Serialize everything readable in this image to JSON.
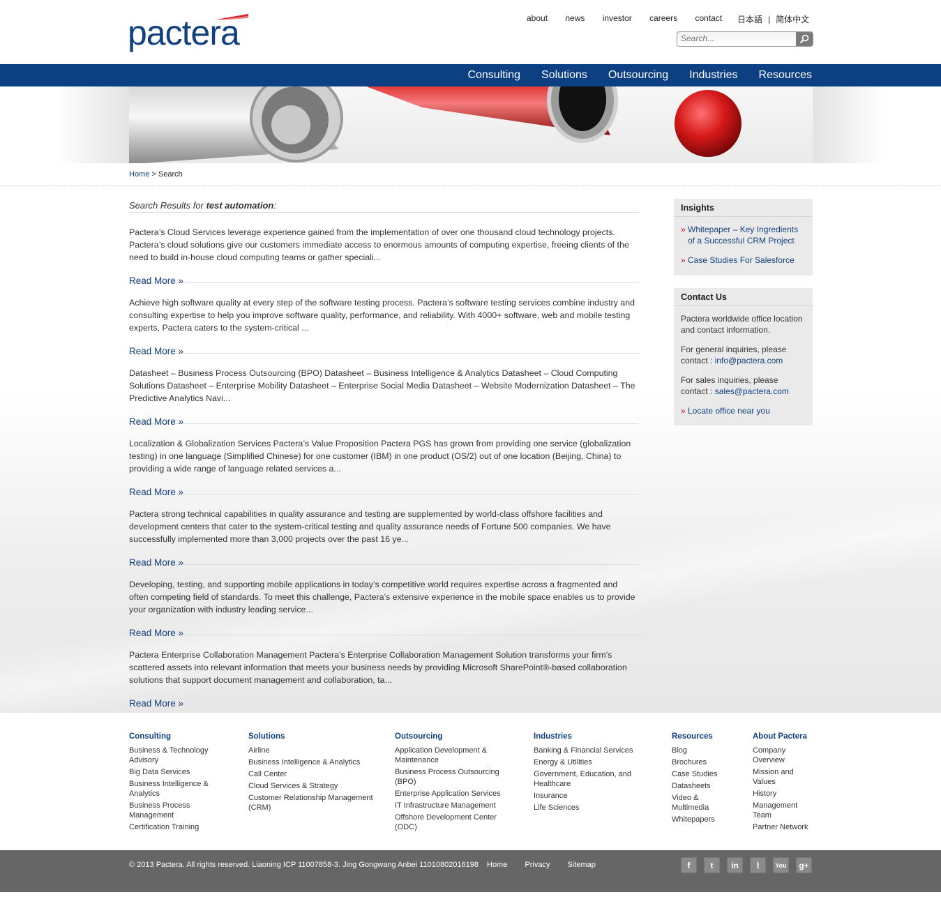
{
  "brand": {
    "logo": "pactera",
    "accent": "#0d3f83",
    "link": "#11407e",
    "bullet": "#c21a1a"
  },
  "top_links": [
    "about",
    "news",
    "investor",
    "careers",
    "contact"
  ],
  "lang": {
    "ja": "日本語",
    "sep": "|",
    "zh": "简体中文"
  },
  "search": {
    "placeholder": "Search..."
  },
  "nav": [
    "Consulting",
    "Solutions",
    "Outsourcing",
    "Industries",
    "Resources"
  ],
  "breadcrumb": {
    "home": "Home",
    "sep": ">",
    "current": "Search"
  },
  "results": {
    "prefix": "Search Results for",
    "query": "test automation",
    "suffix": ":",
    "more": "Read More »",
    "items": [
      "Pactera’s Cloud Services leverage experience gained from the implementation of over one thousand cloud technology projects. Pactera’s cloud solutions give our customers immediate access to enormous amounts of computing expertise, freeing clients of the need to build in-house cloud computing teams or gather speciali...",
      "Achieve high software quality at every step of the software testing process. Pactera’s software testing services combine industry and consulting expertise to help you improve software quality, performance, and reliability. With 4000+ software, web and mobile testing experts, Pactera caters to the system-critical ...",
      "Datasheet – Business Process Outsourcing (BPO) Datasheet – Business Intelligence & Analytics Datasheet – Cloud Computing Solutions Datasheet – Enterprise Mobility Datasheet – Enterprise Social Media Datasheet – Website Modernization Datasheet – The Predictive Analytics Navi...",
      "Localization & Globalization Services Pactera’s Value Proposition Pactera PGS has grown from providing one service (globalization testing) in one language (Simplified Chinese) for one customer (IBM) in one product (OS/2) out of one location (Beijing, China) to providing a wide range of language related services a...",
      "Pactera strong technical capabilities in quality assurance and testing are supplemented by world-class offshore facilities and development centers that cater to the system-critical testing and quality assurance needs of Fortune 500 companies. We have successfully implemented more than 3,000 projects over the past 16 ye...",
      "Developing, testing, and supporting mobile applications in today’s competitive world requires expertise across a fragmented and often competing field of standards. To meet this challenge, Pactera’s extensive experience in the mobile space enables us to provide your organization with industry leading service...",
      "Pactera Enterprise Collaboration Management Pactera’s Enterprise Collaboration Management Solution transforms your firm’s scattered assets into relevant information that meets your business needs by providing Microsoft SharePoint®-based collaboration solutions that support document management and collaboration, ta..."
    ]
  },
  "insights": {
    "title": "Insights",
    "links": [
      "Whitepaper – Key Ingredients of a Successful CRM Project",
      "Case Studies For Salesforce"
    ]
  },
  "contact": {
    "title": "Contact Us",
    "intro": "Pactera worldwide office location and contact information.",
    "general": "For general inquiries, please contact :",
    "general_email": "info@pactera.com",
    "sales": "For sales inquiries, please contact :",
    "sales_email": "sales@pactera.com",
    "locate": "Locate office near you"
  },
  "footer": {
    "columns": [
      {
        "title": "Consulting",
        "items": [
          "Business & Technology Advisory",
          "Big Data Services",
          "Business Intelligence & Analytics",
          "Business Process Management",
          "Certification Training"
        ]
      },
      {
        "title": "Solutions",
        "items": [
          "Airline",
          "Business Intelligence & Analytics",
          "Call Center",
          "Cloud Services & Strategy",
          "Customer Relationship Management (CRM)"
        ]
      },
      {
        "title": "Outsourcing",
        "items": [
          "Application Development & Maintenance",
          "Business Process Outsourcing (BPO)",
          "Enterprise Application Services",
          "IT Infrastructure Management",
          "Offshore Development Center (ODC)"
        ]
      },
      {
        "title": "Industries",
        "items": [
          "Banking & Financial Services",
          "Energy & Utilities",
          "Government, Education, and Healthcare",
          "Insurance",
          "Life Sciences"
        ]
      },
      {
        "title": "Resources",
        "items": [
          "Blog",
          "Brochures",
          "Case Studies",
          "Datasheets",
          "Video & Multimedia",
          "Whitepapers"
        ]
      },
      {
        "title": "About Pactera",
        "items": [
          "Company Overview",
          "Mission and Values",
          "History",
          "Management Team",
          "Partner Network"
        ]
      }
    ],
    "copyright": "© 2013 Pactera. All rights reserved. Liaoning ICP 11007858-3. Jing Gongwang Anbei 11010802016198",
    "links": [
      "Home",
      "Privacy",
      "Sitemap"
    ],
    "social": [
      {
        "icon": "facebook-icon",
        "glyph": "f"
      },
      {
        "icon": "twitter-icon",
        "glyph": "t"
      },
      {
        "icon": "linkedin-icon",
        "glyph": "in"
      },
      {
        "icon": "rss-icon",
        "glyph": "⌇"
      },
      {
        "icon": "youtube-icon",
        "glyph": "You"
      },
      {
        "icon": "googleplus-icon",
        "glyph": "g+"
      }
    ]
  }
}
